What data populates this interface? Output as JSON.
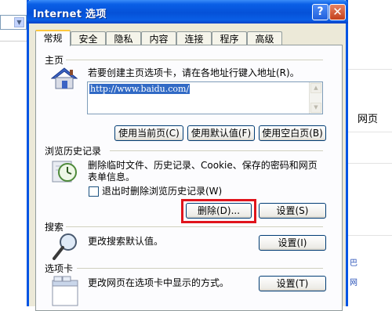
{
  "background": {
    "webpage_label": "网页",
    "fragment_a": "巴",
    "fragment_b": "网"
  },
  "window": {
    "title": "Internet 选项",
    "help_label": "?",
    "close_label": "✕"
  },
  "tabs": [
    {
      "label": "常规",
      "active": true
    },
    {
      "label": "安全",
      "active": false
    },
    {
      "label": "隐私",
      "active": false
    },
    {
      "label": "内容",
      "active": false
    },
    {
      "label": "连接",
      "active": false
    },
    {
      "label": "程序",
      "active": false
    },
    {
      "label": "高级",
      "active": false
    }
  ],
  "homepage": {
    "section_label": "主页",
    "description": "若要创建主页选项卡，请在各地址行键入地址(R)。",
    "url": "http://www.baidu.com/",
    "buttons": {
      "use_current": "使用当前页(C)",
      "use_default": "使用默认值(F)",
      "use_blank": "使用空白页(B)"
    },
    "icon": "house-icon"
  },
  "history": {
    "section_label": "浏览历史记录",
    "description_line1": "删除临时文件、历史记录、Cookie、保存的密码和网页",
    "description_line2": "表单信息。",
    "checkbox_label": "退出时删除浏览历史记录(W)",
    "checkbox_checked": false,
    "delete_label": "删除(D)...",
    "settings_label": "设置(S)",
    "icon": "history-clock-icon",
    "highlight_color": "#e0141c"
  },
  "search": {
    "section_label": "搜索",
    "description": "更改搜索默认值。",
    "settings_label": "设置(I)",
    "icon": "magnifier-icon"
  },
  "tabs_section": {
    "section_label": "选项卡",
    "description": "更改网页在选项卡中显示的方式。",
    "settings_label": "设置(T)",
    "icon": "tabbed-window-icon"
  },
  "colors": {
    "titlebar": "#0a5fe6",
    "dialog_bg": "#ece9d8",
    "selection": "#316ac5"
  }
}
